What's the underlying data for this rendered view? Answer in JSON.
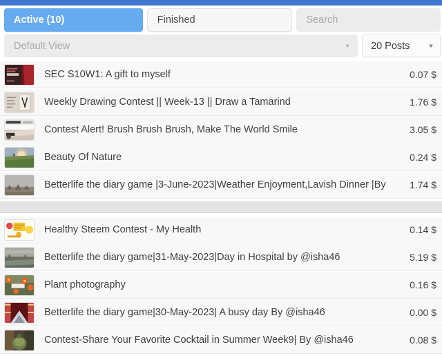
{
  "theme": {
    "accent_bar_color": "#3f77d1",
    "active_tab_color": "#66aaf0",
    "row_background": "#f8f8f8",
    "text_color": "#3f3f3f",
    "placeholder_color": "#a9a9a9"
  },
  "tabs": [
    {
      "id": "active",
      "label": "Active (10)",
      "selected": true
    },
    {
      "id": "finished",
      "label": "Finished",
      "selected": false
    }
  ],
  "search": {
    "placeholder": "Search",
    "value": ""
  },
  "filters": {
    "view": {
      "selected_label": "Default View",
      "caret_icon": "chevron-down-icon"
    },
    "posts_per_page": {
      "selected_label": "20 Posts",
      "caret_icon": "chevron-down-icon"
    }
  },
  "posts_group_1": [
    {
      "title": "SEC S10W1: A gift to myself",
      "payout": "0.07 $",
      "thumb": "dark-red-banner"
    },
    {
      "title": "Weekly Drawing Contest || Week-13 || Draw a Tamarind",
      "payout": "1.76 $",
      "thumb": "beige-sketch"
    },
    {
      "title": "Contest Alert! Brush Brush Brush, Make The World Smile",
      "payout": "3.05 $",
      "thumb": "white-banner-brush"
    },
    {
      "title": "Beauty Of Nature",
      "payout": "0.24 $",
      "thumb": "sunset-field"
    },
    {
      "title": "Betterlife the diary game |3-June-2023|Weather Enjoyment,Lavish Dinner |By",
      "payout": "1.74 $",
      "thumb": "dusk-village"
    }
  ],
  "posts_group_2": [
    {
      "title": "Healthy Steem Contest - My Health",
      "payout": "0.14 $",
      "thumb": "yellow-health-badge"
    },
    {
      "title": "Betterlife the diary game|31-May-2023|Day in Hospital by @isha46",
      "payout": "5.19 $",
      "thumb": "beach-sunset"
    },
    {
      "title": "Plant photography",
      "payout": "0.16 $",
      "thumb": "orange-flowers"
    },
    {
      "title": "Betterlife the diary game|30-May-2023| A busy day By @isha46",
      "payout": "0.00 $",
      "thumb": "red-curtain"
    },
    {
      "title": "Contest-Share Your Favorite Cocktail in Summer Week9| By @isha46",
      "payout": "0.08 $",
      "thumb": "green-pot"
    }
  ]
}
